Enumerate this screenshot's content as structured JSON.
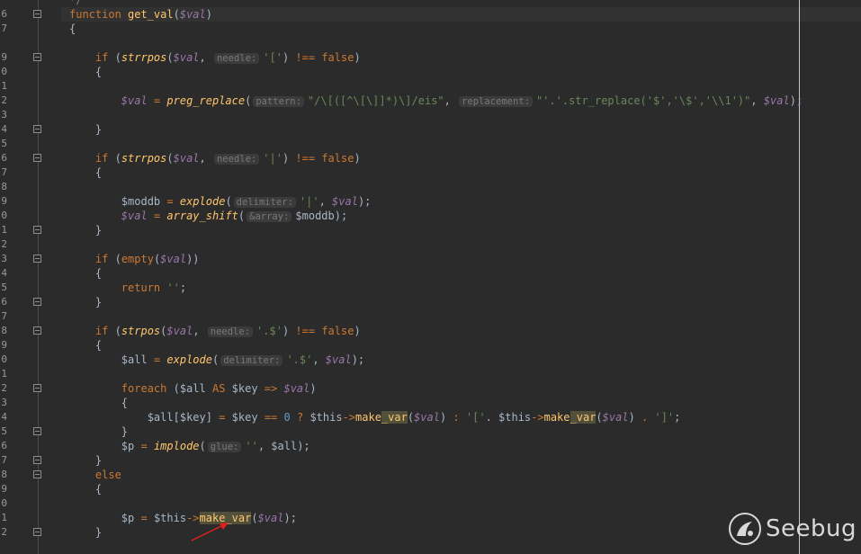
{
  "editor": {
    "line_numbers": [
      "",
      "6",
      "7",
      "",
      "9",
      "0",
      "1",
      "2",
      "3",
      "4",
      "5",
      "6",
      "7",
      "8",
      "9",
      "0",
      "1",
      "2",
      "3",
      "4",
      "5",
      "6",
      "7",
      "8",
      "9",
      "0",
      "1",
      "2",
      "3",
      "4",
      "5",
      "6",
      "7",
      "8",
      "9",
      "0",
      "1",
      "2"
    ],
    "comment_top": "*/",
    "fn_keyword": "function",
    "fn_name": "get_val",
    "fn_param": "$val",
    "hints": {
      "needle": "needle:",
      "pattern": "pattern:",
      "replacement": "replacement:",
      "delimiter": "delimiter:",
      "array": "&array:",
      "glue": "glue:"
    },
    "strings": {
      "bracket": "'['",
      "pipe": "'|'",
      "dot_dollar": "'.$'",
      "regex": "\"/\\[([^\\[\\]]*)\\]/eis\"",
      "replacement_a": "\"'.'.str_replace('$','\\$','\\\\1')\"",
      "empty": "''",
      "close_bracket": "']'",
      "lbracket_glue": "'['"
    }
  },
  "watermark": {
    "text": "Seebug"
  },
  "colors": {
    "background": "#2b2b2b",
    "keyword": "#cc7832",
    "function": "#ffc66d",
    "variable": "#9876aa",
    "string": "#6a8759"
  }
}
